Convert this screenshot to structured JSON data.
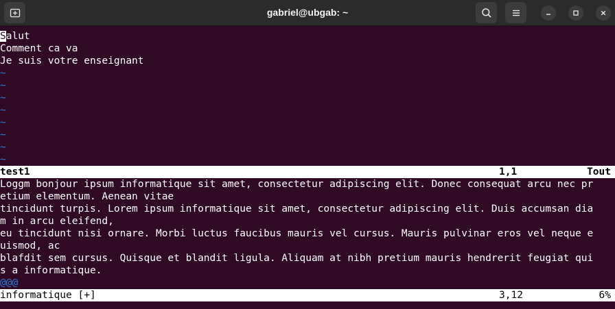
{
  "window": {
    "title": "gabriel@ubgab: ~"
  },
  "icons": {
    "new_tab": "new-tab-icon",
    "search": "search-icon",
    "menu": "hamburger-menu-icon",
    "minimize": "minimize-icon",
    "maximize": "maximize-icon",
    "close": "close-icon"
  },
  "top_pane": {
    "cursor_char": "S",
    "first_line_rest": "alut",
    "lines": [
      "Comment ca va",
      "Je suis votre enseignant"
    ],
    "tilde": "~",
    "status": {
      "filename": "test1",
      "position": "1,1",
      "percent": "Tout"
    }
  },
  "bottom_pane": {
    "lines": [
      "Loggm bonjour ipsum informatique sit amet, consectetur adipiscing elit. Donec consequat arcu nec pr",
      "etium elementum. Aenean vitae",
      "tincidunt turpis. Lorem ipsum informatique sit amet, consectetur adipiscing elit. Duis accumsan dia",
      "m in arcu eleifend,",
      "eu tincidunt nisi ornare. Morbi luctus faucibus mauris vel cursus. Mauris pulvinar eros vel neque e",
      "uismod, ac",
      "blafdit sem cursus. Quisque et blandit ligula. Aliquam at nibh pretium mauris hendrerit feugiat qui",
      "s a informatique."
    ],
    "overflow_marker": "@@@",
    "status": {
      "filename": "informatique [+]",
      "position": "3,12",
      "percent": "6%"
    }
  },
  "colors": {
    "background": "#300a24",
    "tilde": "#2a7bde",
    "status_bg": "#ffffff",
    "titlebar": "#2b2b2b"
  }
}
